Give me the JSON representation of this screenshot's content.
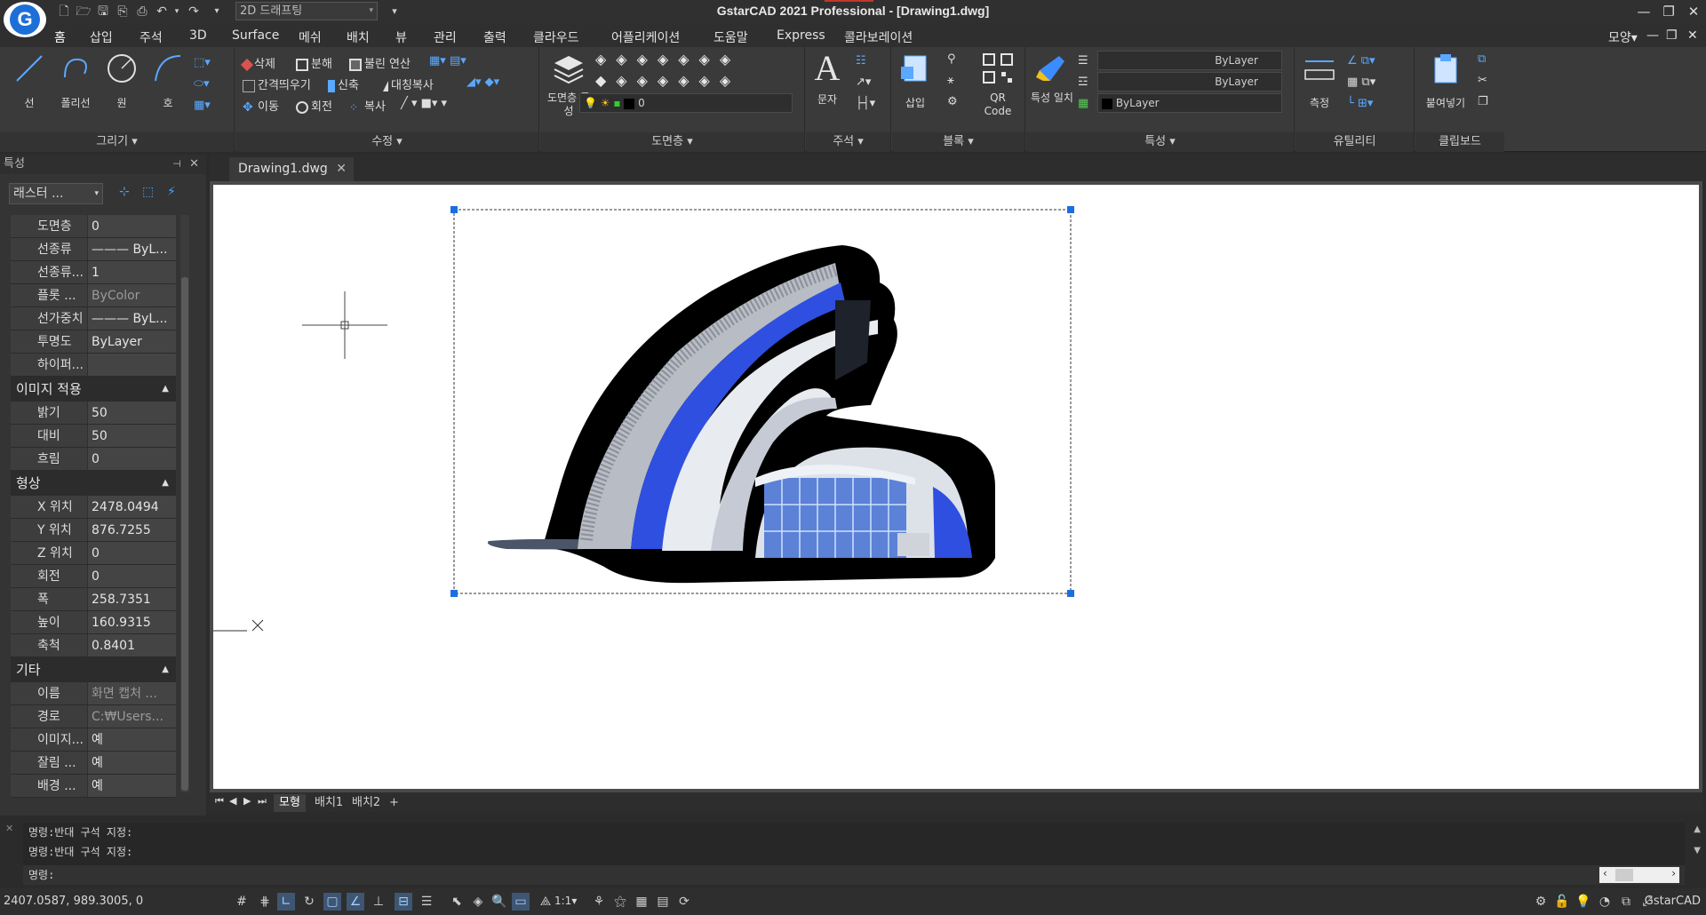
{
  "titlebar": {
    "workspace": "2D 드래프팅",
    "title": "GstarCAD 2021 Professional - [Drawing1.dwg]",
    "right_menu": "모양"
  },
  "menus": [
    "홈",
    "삽입",
    "주석",
    "3D",
    "Surface",
    "메쉬",
    "배치",
    "뷰",
    "관리",
    "출력",
    "클라우드",
    "어플리케이션",
    "도움말",
    "Express",
    "콜라보레이션"
  ],
  "ribbon": {
    "draw": {
      "title": "그리기",
      "line": "선",
      "polyline": "폴리선",
      "circle": "원",
      "arc": "호"
    },
    "modify": {
      "title": "수정",
      "erase": "삭제",
      "explode": "분해",
      "boolean": "불린 연산",
      "offset": "간격띄우기",
      "stretch": "신축",
      "mirror": "대칭복사",
      "move": "이동",
      "rotate": "회전",
      "copy": "복사"
    },
    "layer": {
      "title": "도면층",
      "props": "도면층 특성",
      "current": "0"
    },
    "annotation": {
      "title": "주석",
      "text": "문자"
    },
    "block": {
      "title": "블록",
      "insert": "삽입",
      "qr": "QR Code"
    },
    "properties": {
      "title": "특성",
      "match": "특성 일치",
      "linetype": "ByLayer",
      "lineweight": "ByLayer",
      "color": "ByLayer"
    },
    "utilities": {
      "title": "유틸리티",
      "measure": "측정"
    },
    "clipboard": {
      "title": "클립보드",
      "paste": "붙여넣기"
    }
  },
  "props": {
    "header": "특성",
    "object_type": "래스터 ...",
    "general": [
      {
        "k": "도면층",
        "v": "0"
      },
      {
        "k": "선종류",
        "v": "——— ByL..."
      },
      {
        "k": "선종류...",
        "v": "1"
      },
      {
        "k": "플롯 ...",
        "v": "ByColor",
        "dim": true
      },
      {
        "k": "선가중치",
        "v": "——— ByL..."
      },
      {
        "k": "투명도",
        "v": "ByLayer"
      },
      {
        "k": "하이퍼...",
        "v": ""
      }
    ],
    "image_adjust": {
      "title": "이미지 적용",
      "rows": [
        {
          "k": "밝기",
          "v": "50"
        },
        {
          "k": "대비",
          "v": "50"
        },
        {
          "k": "흐림",
          "v": "0"
        }
      ]
    },
    "geometry": {
      "title": "형상",
      "rows": [
        {
          "k": "X 위치",
          "v": "2478.0494"
        },
        {
          "k": "Y 위치",
          "v": "876.7255"
        },
        {
          "k": "Z 위치",
          "v": "0"
        },
        {
          "k": "회전",
          "v": "0"
        },
        {
          "k": "폭",
          "v": "258.7351"
        },
        {
          "k": "높이",
          "v": "160.9315"
        },
        {
          "k": "축척",
          "v": "0.8401"
        }
      ]
    },
    "misc": {
      "title": "기타",
      "rows": [
        {
          "k": "이름",
          "v": "화면 캡처 ...",
          "dim": true
        },
        {
          "k": "경로",
          "v": "C:₩Users...",
          "dim": true
        },
        {
          "k": "이미지...",
          "v": "예"
        },
        {
          "k": "잘림 ...",
          "v": "예"
        },
        {
          "k": "배경 ...",
          "v": "예"
        }
      ]
    }
  },
  "document": {
    "tab": "Drawing1.dwg"
  },
  "layout_tabs": [
    "모형",
    "배치1",
    "배치2",
    "+"
  ],
  "command": {
    "history": [
      "명령:반대 구석 지정:",
      "명령:반대 구석 지정:"
    ],
    "prompt": "명령:"
  },
  "status": {
    "coords": "2407.0587, 989.3005, 0",
    "scale": "1:1",
    "brand": "GstarCAD"
  },
  "colors": {
    "accent_blue": "#1d6fd8",
    "building_blue": "#2f4fe0",
    "grip": "#1a6fe0"
  }
}
